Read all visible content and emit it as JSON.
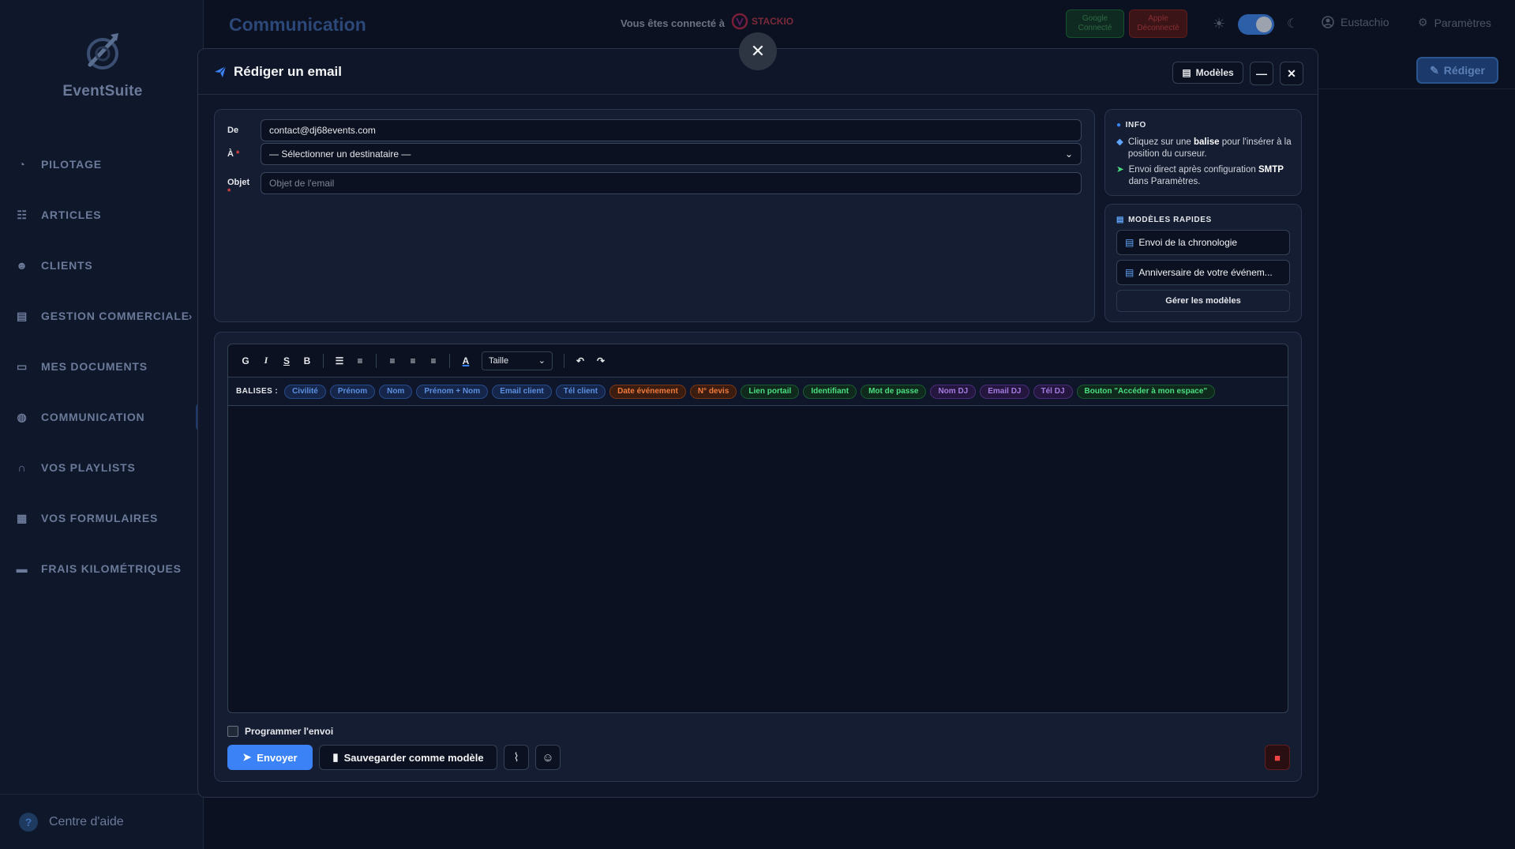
{
  "app": {
    "name": "EventSuite"
  },
  "sidebar": {
    "items": [
      {
        "label": "PILOTAGE",
        "icon": "gauge-icon"
      },
      {
        "label": "ARTICLES",
        "icon": "sliders-icon"
      },
      {
        "label": "CLIENTS",
        "icon": "users-icon"
      },
      {
        "label": "GESTION COMMERCIALE",
        "icon": "document-icon",
        "chevron": "›"
      },
      {
        "label": "MES DOCUMENTS",
        "icon": "folder-icon"
      },
      {
        "label": "COMMUNICATION",
        "icon": "chat-icon",
        "active": true
      },
      {
        "label": "VOS PLAYLISTS",
        "icon": "headphones-icon"
      },
      {
        "label": "VOS FORMULAIRES",
        "icon": "form-icon"
      },
      {
        "label": "FRAIS KILOMÉTRIQUES",
        "icon": "car-icon"
      }
    ],
    "help": {
      "label": "Centre d'aide",
      "icon": "?"
    }
  },
  "header": {
    "title": "Communication",
    "connected_text": "Vous êtes connecté à",
    "brand_name": "STACKIO",
    "google": {
      "label": "Google",
      "status": "Connecté"
    },
    "apple": {
      "label": "Apple",
      "status": "Déconnecté"
    },
    "user": "Eustachio",
    "settings": "Paramètres",
    "compose_label": "Rédiger"
  },
  "overlay": {
    "close_symbol": "✕"
  },
  "modal": {
    "title": "Rédiger un email",
    "models_label": "Modèles",
    "minimize_symbol": "—",
    "close_symbol": "✕",
    "fields": {
      "from_label": "De",
      "from_value": "contact@dj68events.com",
      "to_label": "À",
      "to_value": "— Sélectionner un destinataire —",
      "subject_label": "Objet",
      "subject_placeholder": "Objet de l'email",
      "required_mark": "*"
    },
    "info": {
      "title": "INFO",
      "line1_pre": "Cliquez sur une",
      "line1_bold": "balise",
      "line1_post": "pour l'insérer à la position du curseur.",
      "line2_pre": "Envoi direct après configuration",
      "line2_bold": "SMTP",
      "line2_post": "dans Paramètres."
    },
    "rapid": {
      "title": "MODÈLES RAPIDES",
      "templates": [
        "Envoi de la chronologie",
        "Anniversaire de votre événem..."
      ],
      "manage": "Gérer les modèles"
    },
    "toolbar": {
      "bold_g": "G",
      "italic": "I",
      "strike": "S",
      "bold_b": "B",
      "size_label": "Taille"
    },
    "tags": {
      "label": "BALISES :",
      "items": [
        {
          "text": "Civilité",
          "color": "blue"
        },
        {
          "text": "Prénom",
          "color": "blue"
        },
        {
          "text": "Nom",
          "color": "blue"
        },
        {
          "text": "Prénom + Nom",
          "color": "blue"
        },
        {
          "text": "Email client",
          "color": "blue"
        },
        {
          "text": "Tél client",
          "color": "blue"
        },
        {
          "text": "Date événement",
          "color": "orange"
        },
        {
          "text": "N° devis",
          "color": "orange"
        },
        {
          "text": "Lien portail",
          "color": "green"
        },
        {
          "text": "Identifiant",
          "color": "green"
        },
        {
          "text": "Mot de passe",
          "color": "green"
        },
        {
          "text": "Nom DJ",
          "color": "purple"
        },
        {
          "text": "Email DJ",
          "color": "purple"
        },
        {
          "text": "Tél DJ",
          "color": "purple"
        },
        {
          "text": "Bouton \"Accéder à mon espace\"",
          "color": "green"
        }
      ]
    },
    "schedule_label": "Programmer l'envoi",
    "send_label": "Envoyer",
    "save_template_label": "Sauvegarder comme modèle"
  },
  "colors": {
    "accent": "#3b82f6",
    "background": "#0b1120",
    "danger": "#ef4444"
  }
}
